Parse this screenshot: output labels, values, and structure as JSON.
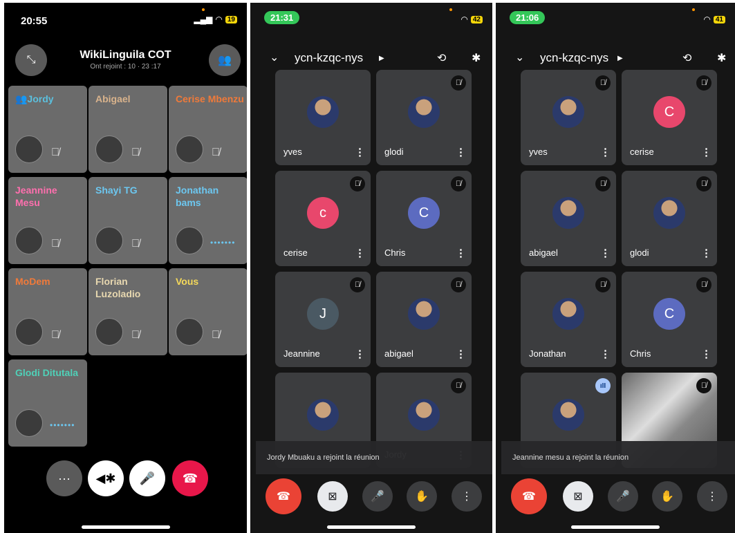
{
  "phone1": {
    "time": "20:55",
    "battery": "19",
    "title": "WikiLinguila COT",
    "subtitle": "Ont rejoint : 10 · 23 :17",
    "participants": [
      {
        "name": "👥Jordy",
        "color": "#5bc0de",
        "state": "muted"
      },
      {
        "name": "Abigael",
        "color": "#d9b38c",
        "state": "muted"
      },
      {
        "name": "Cerise Mbenzu",
        "color": "#f07a3a",
        "state": "muted"
      },
      {
        "name": "Jeannine Mesu",
        "color": "#ff6fae",
        "state": "muted"
      },
      {
        "name": "Shayi TG",
        "color": "#6cc7f0",
        "state": "muted"
      },
      {
        "name": "Jonathan bams",
        "color": "#6cc7f0",
        "state": "connecting"
      },
      {
        "name": "MoDem",
        "color": "#f07a3a",
        "state": "muted"
      },
      {
        "name": "Florian Luzoladio",
        "color": "#e8d8b0",
        "state": "muted"
      },
      {
        "name": "Vous",
        "color": "#f5d95a",
        "state": "muted"
      },
      {
        "name": "Glodi Ditutala",
        "color": "#4fd1b8",
        "state": "connecting"
      }
    ],
    "controls": {
      "more": "···",
      "audio": "◀✱",
      "mic": "🎤",
      "end": "☎"
    }
  },
  "phone2": {
    "time": "21:31",
    "battery": "42",
    "meeting_code": "ycn-kzqc-nys",
    "tiles": [
      {
        "name": "yves",
        "kind": "photo",
        "badge": "none"
      },
      {
        "name": "glodi",
        "kind": "photo",
        "badge": "muted"
      },
      {
        "name": "cerise",
        "kind": "letter",
        "letter": "c",
        "color": "#e8476c",
        "badge": "muted"
      },
      {
        "name": "Chris",
        "kind": "letter",
        "letter": "C",
        "color": "#5c6bc0",
        "badge": "muted"
      },
      {
        "name": "Jeannine",
        "kind": "letter",
        "letter": "J",
        "color": "#4a5963",
        "badge": "muted"
      },
      {
        "name": "abigael",
        "kind": "photo",
        "badge": "muted"
      },
      {
        "name": "",
        "kind": "photo",
        "badge": "none"
      },
      {
        "name": "Jordy",
        "kind": "photo",
        "badge": "muted"
      }
    ],
    "toast": "Jordy Mbuaku a rejoint la réunion"
  },
  "phone3": {
    "time": "21:06",
    "battery": "41",
    "meeting_code": "ycn-kzqc-nys",
    "tiles": [
      {
        "name": "yves",
        "kind": "photo",
        "badge": "muted"
      },
      {
        "name": "cerise",
        "kind": "letter",
        "letter": "C",
        "color": "#e8476c",
        "badge": "muted"
      },
      {
        "name": "abigael",
        "kind": "photo",
        "badge": "muted"
      },
      {
        "name": "glodi",
        "kind": "photo",
        "badge": "muted"
      },
      {
        "name": "Jonathan",
        "kind": "photo",
        "badge": "muted"
      },
      {
        "name": "Chris",
        "kind": "letter",
        "letter": "C",
        "color": "#5c6bc0",
        "badge": "muted"
      },
      {
        "name": "",
        "kind": "photo",
        "badge": "speaking"
      },
      {
        "name": "",
        "kind": "video",
        "badge": "muted"
      }
    ],
    "toast": "Jeannine mesu a rejoint la réunion"
  },
  "icons": {
    "muted_mic": "🎙̸",
    "more_vert": "⋮",
    "chevron": "⌄",
    "flip_camera": "⟲",
    "bluetooth": "✱",
    "video_off": "⊠",
    "mic": "🎤",
    "hand": "✋",
    "end_call": "☎"
  }
}
